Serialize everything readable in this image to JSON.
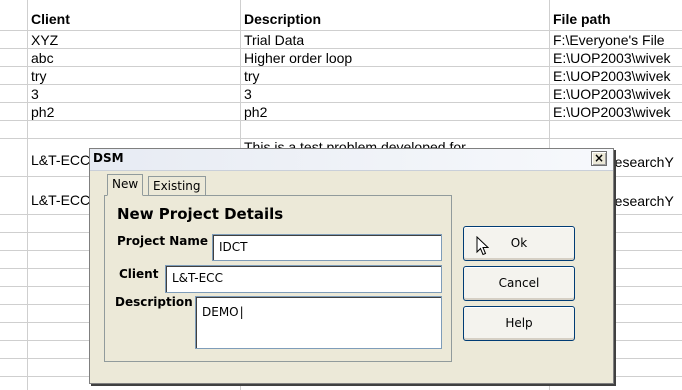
{
  "spreadsheet": {
    "headers": [
      "Client",
      "Description",
      "File path"
    ],
    "rows": [
      [
        "XYZ",
        "Trial Data",
        "F:\\Everyone's File"
      ],
      [
        "abc",
        "Higher order loop",
        "E:\\UOP2003\\wivek"
      ],
      [
        "try",
        "try",
        "E:\\UOP2003\\wivek"
      ],
      [
        "3",
        "3",
        "E:\\UOP2003\\wivek"
      ],
      [
        "ph2",
        "ph2",
        "E:\\UOP2003\\wivek"
      ]
    ],
    "desc_overflow": "This is a test problem developed for",
    "client_l1": "L&T-ECC",
    "client_l2": "L&T-ECC",
    "path_l1": "researchY",
    "path_l2": "researchY"
  },
  "dialog": {
    "title": "DSM",
    "close_glyph": "×",
    "tabs": {
      "new": "New",
      "existing": "Existing"
    },
    "panel_title": "New Project Details",
    "project_name_label": "Project Name",
    "project_name_value": "IDCT",
    "client_label": "Client",
    "client_value": "L&T-ECC",
    "description_label": "Description",
    "description_value": "DEMO",
    "buttons": {
      "ok": "Ok",
      "cancel": "Cancel",
      "help": "Help"
    }
  }
}
